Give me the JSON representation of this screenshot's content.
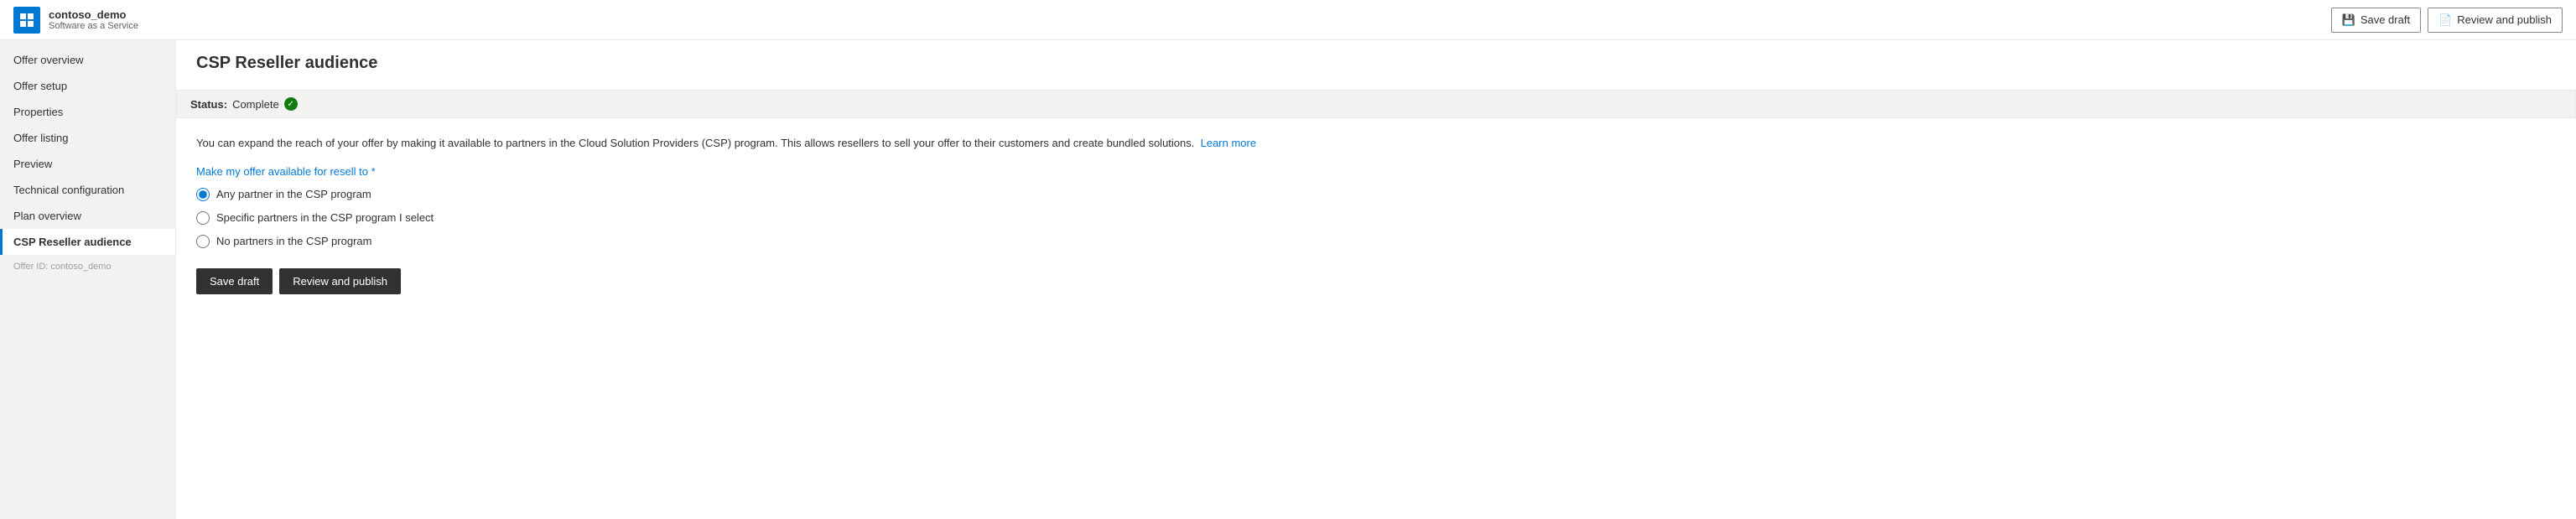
{
  "app": {
    "name": "contoso_demo",
    "subtitle": "Software as a Service",
    "icon": "grid-icon"
  },
  "header": {
    "save_draft_label": "Save draft",
    "review_publish_label": "Review and publish",
    "save_icon": "save-icon",
    "publish_icon": "publish-icon"
  },
  "sidebar": {
    "items": [
      {
        "id": "offer-overview",
        "label": "Offer overview",
        "active": false
      },
      {
        "id": "offer-setup",
        "label": "Offer setup",
        "active": false
      },
      {
        "id": "properties",
        "label": "Properties",
        "active": false
      },
      {
        "id": "offer-listing",
        "label": "Offer listing",
        "active": false
      },
      {
        "id": "preview",
        "label": "Preview",
        "active": false
      },
      {
        "id": "technical-configuration",
        "label": "Technical configuration",
        "active": false
      },
      {
        "id": "plan-overview",
        "label": "Plan overview",
        "active": false
      },
      {
        "id": "csp-reseller-audience",
        "label": "CSP Reseller audience",
        "active": true
      }
    ],
    "offer_id_label": "Offer ID: contoso_demo"
  },
  "page": {
    "title": "CSP Reseller audience",
    "status_label": "Status:",
    "status_value": "Complete",
    "description": "You can expand the reach of your offer by making it available to partners in the Cloud Solution Providers (CSP) program. This allows resellers to sell your offer to their customers and create bundled solutions.",
    "learn_more_label": "Learn more",
    "section_label": "Make my offer available for resell to *",
    "radio_options": [
      {
        "id": "any-partner",
        "label": "Any partner in the CSP program",
        "checked": true
      },
      {
        "id": "specific-partners",
        "label": "Specific partners in the CSP program I select",
        "checked": false
      },
      {
        "id": "no-partners",
        "label": "No partners in the CSP program",
        "checked": false
      }
    ],
    "save_draft_label": "Save draft",
    "review_publish_label": "Review and publish"
  }
}
